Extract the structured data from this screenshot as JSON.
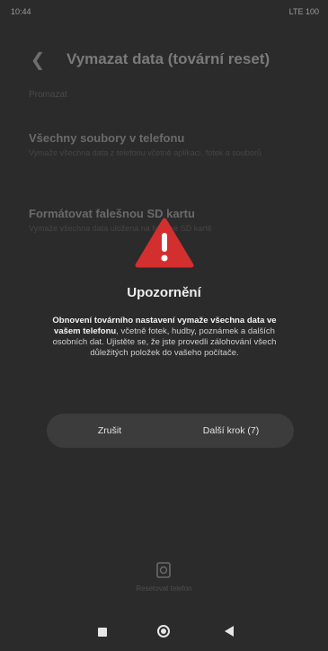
{
  "status_bar": {
    "time": "10:44",
    "right": "LTE 100"
  },
  "header": {
    "title": "Vymazat data (tovární reset)"
  },
  "section": {
    "label": "Promazat"
  },
  "settings": [
    {
      "title": "Všechny soubory v telefonu",
      "subtitle": "Vymaže všechna data z telefonu včetně aplikací, fotek a souborů"
    },
    {
      "title": "Formátovat falešnou SD kartu",
      "subtitle": "Vymaže všechna data uložená na falešné SD kartě"
    }
  ],
  "dialog": {
    "title": "Upozornění",
    "body_bold": "Obnovení továrního nastavení vymaže všechna data ve vašem telefonu",
    "body_rest": ", včetně fotek, hudby, poznámek a dalších osobních dat. Ujistěte se, že jste provedli zálohování všech důležitých položek do vašeho počítače.",
    "cancel_label": "Zrušit",
    "next_label": "Další krok (7)"
  },
  "bottom": {
    "label": "Resetovat telefon"
  },
  "icons": {
    "back": "back-arrow-icon",
    "warning": "warning-triangle-icon",
    "reset": "reset-icon",
    "nav_recents": "recents-square-icon",
    "nav_home": "home-circle-icon",
    "nav_back": "back-triangle-icon"
  },
  "colors": {
    "warning_red": "#d32f2f",
    "background": "#2b2b2b",
    "button_bg": "#3c3c3c"
  }
}
